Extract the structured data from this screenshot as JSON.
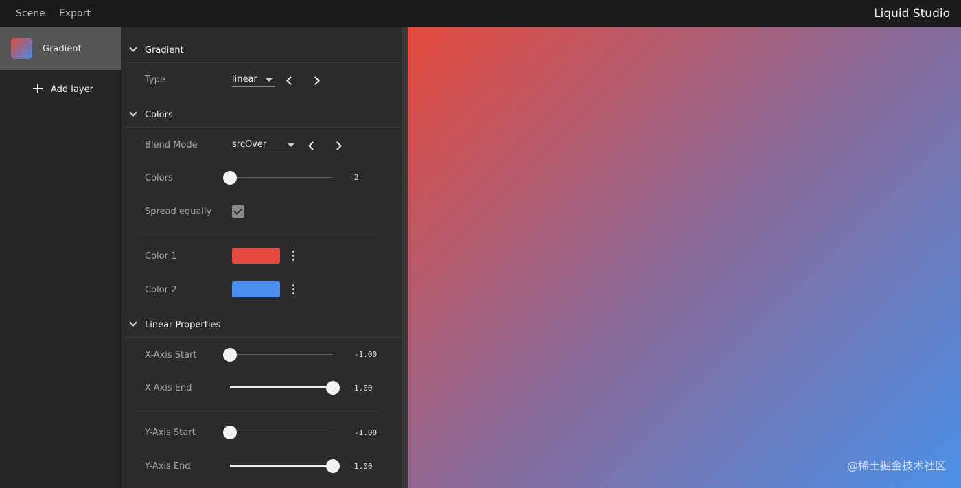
{
  "menu": {
    "scene": "Scene",
    "export": "Export"
  },
  "app_title": "Liquid Studio",
  "sidebar": {
    "layers": [
      {
        "name": "Gradient"
      }
    ],
    "add_layer_label": "Add layer"
  },
  "sections": {
    "gradient": {
      "title": "Gradient",
      "type_label": "Type",
      "type_value": "linear"
    },
    "colors": {
      "title": "Colors",
      "blend_label": "Blend Mode",
      "blend_value": "srcOver",
      "colors_label": "Colors",
      "colors_count": "2",
      "colors_fraction": 0.0,
      "spread_label": "Spread equally",
      "spread_checked": true,
      "color_items": [
        {
          "label": "Color 1",
          "color": "#e5493d"
        },
        {
          "label": "Color 2",
          "color": "#4a8ef0"
        }
      ]
    },
    "linear": {
      "title": "Linear Properties",
      "sliders": [
        {
          "label": "X-Axis Start",
          "value": "-1.00",
          "fraction": 0.0
        },
        {
          "label": "X-Axis End",
          "value": "1.00",
          "fraction": 1.0
        },
        {
          "label": "Y-Axis Start",
          "value": "-1.00",
          "fraction": 0.0
        },
        {
          "label": "Y-Axis End",
          "value": "1.00",
          "fraction": 1.0
        }
      ]
    }
  },
  "preview": {
    "gradient_colors": [
      "#e54a3c",
      "#4a90e8"
    ]
  },
  "watermark": "@稀土掘金技术社区"
}
